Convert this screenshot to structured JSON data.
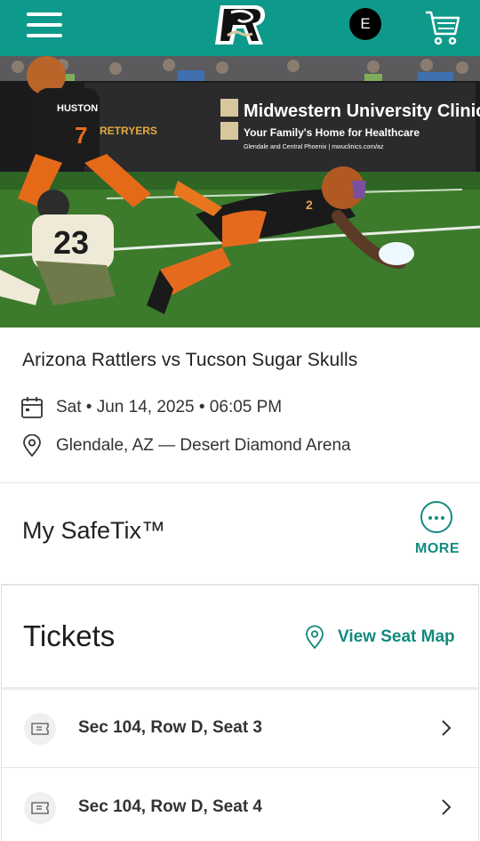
{
  "header": {
    "menu_icon": "hamburger-menu-icon",
    "logo_icon": "rattlers-logo-icon",
    "avatar_initial": "E",
    "cart_icon": "shopping-cart-icon",
    "background_color": "#0e9a8a"
  },
  "hero": {
    "banner_title": "Midwestern University Clinics",
    "banner_subtitle": "Your Family's Home for Healthcare",
    "banner_small": "Glendale and Central Phoenix | mwuclinics.com/az",
    "ad_text": "RETRYERS",
    "player_left_name": "HUSTON",
    "player_left_number": "7",
    "player_mid_number": "23",
    "player_dive_number": "2"
  },
  "event": {
    "title": "Arizona Rattlers vs Tucson Sugar Skulls",
    "date_time": "Sat • Jun 14, 2025 • 06:05 PM",
    "location": "Glendale, AZ — Desert Diamond Arena",
    "calendar_icon": "calendar-icon",
    "location_icon": "location-pin-icon"
  },
  "safetix": {
    "title": "My SafeTix™",
    "more_label": "MORE",
    "more_icon": "more-dots-icon"
  },
  "tickets": {
    "title": "Tickets",
    "seat_map_label": "View Seat Map",
    "seat_map_icon": "map-pin-icon",
    "items": [
      {
        "label": "Sec 104, Row D, Seat 3"
      },
      {
        "label": "Sec 104, Row D, Seat 4"
      }
    ]
  },
  "colors": {
    "accent": "#128a7e",
    "header": "#0e9a8a"
  }
}
